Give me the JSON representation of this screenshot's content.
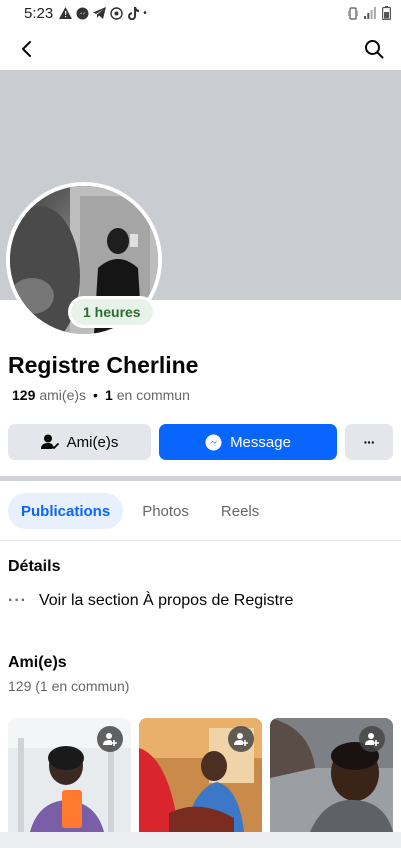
{
  "status_bar": {
    "time": "5:23",
    "notification_icons": [
      "warning-icon",
      "messenger-icon",
      "telegram-icon",
      "whatsapp-icon",
      "tiktok-icon",
      "dot-icon"
    ],
    "right_icons": [
      "vibrate-icon",
      "signal-icon",
      "battery-icon"
    ]
  },
  "top_bar": {
    "back_icon": "back-arrow-icon",
    "search_icon": "search-icon"
  },
  "profile": {
    "status_badge": "1 heures",
    "name": "Registre Cherline",
    "friends_count": "129",
    "friends_label": "ami(e)s",
    "separator": "•",
    "mutual_count": "1",
    "mutual_label": "en commun"
  },
  "actions": {
    "friends_label": "Ami(e)s",
    "message_label": "Message",
    "more_label": "···"
  },
  "tabs": [
    {
      "label": "Publications",
      "active": true
    },
    {
      "label": "Photos",
      "active": false
    },
    {
      "label": "Reels",
      "active": false
    }
  ],
  "details": {
    "title": "Détails",
    "item_label": "Voir la section À propos de Registre"
  },
  "friends_section": {
    "title": "Ami(e)s",
    "count_text": "129 (1 en commun)"
  },
  "colors": {
    "accent": "#0866ff",
    "cover": "#c9ccd1",
    "badge_bg": "#e7f3e8",
    "badge_text": "#2e6b2f"
  }
}
